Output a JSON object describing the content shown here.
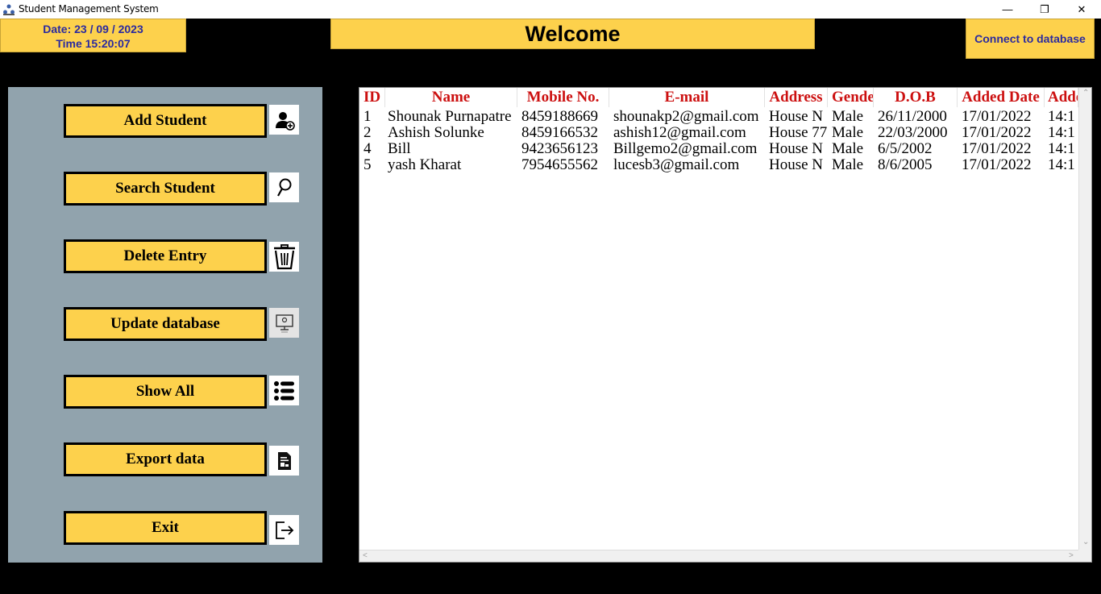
{
  "window": {
    "title": "Student Management System",
    "minimize_glyph": "—",
    "maximize_glyph": "❐",
    "close_glyph": "✕"
  },
  "header": {
    "date": "Date: 23 / 09 / 2023",
    "time": "Time 15:20:07",
    "welcome": "Welcome",
    "connect_label": "Connect to database"
  },
  "sidebar": {
    "buttons": [
      {
        "label": "Add Student",
        "icon": "add-user-icon"
      },
      {
        "label": "Search Student",
        "icon": "search-icon"
      },
      {
        "label": "Delete Entry",
        "icon": "trash-icon"
      },
      {
        "label": "Update database",
        "icon": "update-monitor-icon"
      },
      {
        "label": "Show All",
        "icon": "list-icon"
      },
      {
        "label": "Export data",
        "icon": "export-file-icon"
      },
      {
        "label": "Exit",
        "icon": "exit-icon"
      }
    ]
  },
  "table": {
    "columns": [
      "ID",
      "Name",
      "Mobile No.",
      "E-mail",
      "Address",
      "Gender",
      "D.O.B",
      "Added Date",
      "Added Time"
    ],
    "rows": [
      [
        "1",
        "Shounak Purnapatre",
        "8459188669",
        "shounakp2@gmail.com",
        "House N",
        "Male",
        "26/11/2000",
        "17/01/2022",
        "14:1"
      ],
      [
        "2",
        "Ashish Solunke",
        "8459166532",
        "ashish12@gmail.com",
        "House 77",
        "Male",
        "22/03/2000",
        "17/01/2022",
        "14:1"
      ],
      [
        "4",
        "Bill",
        "9423656123",
        "Billgemo2@gmail.com",
        "House N",
        "Male",
        "6/5/2002",
        "17/01/2022",
        "14:1"
      ],
      [
        "5",
        "yash Kharat",
        "7954655562",
        "lucesb3@gmail.com",
        "House N",
        "Male",
        "8/6/2005",
        "17/01/2022",
        "14:1"
      ]
    ]
  },
  "colors": {
    "accent_yellow": "#fdd14c",
    "panel_grey": "#91a3ad",
    "header_red": "#cc1010",
    "label_blue": "#2a2aa0"
  }
}
